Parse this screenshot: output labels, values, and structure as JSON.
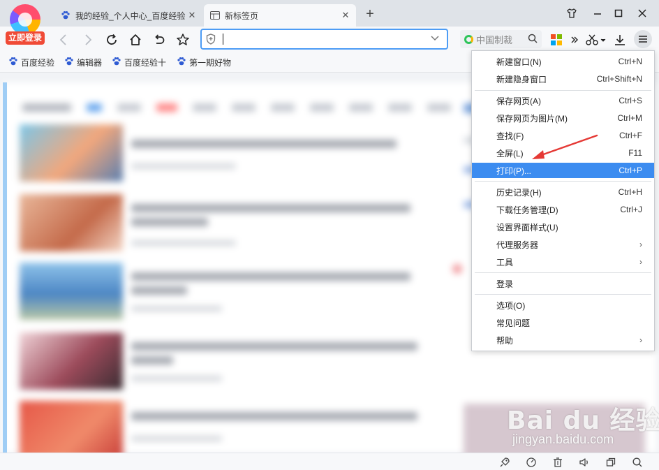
{
  "browser": {
    "login_badge": "立即登录",
    "tabs": [
      {
        "title": "我的经验_个人中心_百度经验",
        "close": "✕",
        "active": false
      },
      {
        "title": "新标签页",
        "close": "✕",
        "active": true
      }
    ],
    "new_tab": "+"
  },
  "address_bar": {
    "value": "",
    "placeholder": ""
  },
  "search_box": {
    "placeholder": "中国制裁"
  },
  "bookmarks": [
    {
      "label": "百度经验"
    },
    {
      "label": "编辑器"
    },
    {
      "label": "百度经验十"
    },
    {
      "label": "第一期好物"
    }
  ],
  "menu": {
    "items": [
      {
        "label": "新建窗口(N)",
        "shortcut": "Ctrl+N"
      },
      {
        "label": "新建隐身窗口",
        "shortcut": "Ctrl+Shift+N"
      },
      {
        "label": "保存网页(A)",
        "shortcut": "Ctrl+S"
      },
      {
        "label": "保存网页为图片(M)",
        "shortcut": "Ctrl+M"
      },
      {
        "label": "查找(F)",
        "shortcut": "Ctrl+F"
      },
      {
        "label": "全屏(L)",
        "shortcut": "F11"
      },
      {
        "label": "打印(P)...",
        "shortcut": "Ctrl+P"
      },
      {
        "label": "历史记录(H)",
        "shortcut": "Ctrl+H"
      },
      {
        "label": "下载任务管理(D)",
        "shortcut": "Ctrl+J"
      },
      {
        "label": "设置界面样式(U)",
        "shortcut": ""
      },
      {
        "label": "代理服务器",
        "shortcut": ""
      },
      {
        "label": "工具",
        "shortcut": ""
      },
      {
        "label": "登录",
        "shortcut": ""
      },
      {
        "label": "选项(O)",
        "shortcut": ""
      },
      {
        "label": "常见问题",
        "shortcut": ""
      },
      {
        "label": "帮助",
        "shortcut": ""
      }
    ],
    "submenu_arrow": "›"
  },
  "watermark": {
    "brand": "Bai du 经验",
    "url": "jingyan.baidu.com"
  },
  "colors": {
    "accent": "#3c8cf0",
    "address_border": "#4d9cf5",
    "login_badge": "#f04a36",
    "annotation_arrow": "#e53935"
  }
}
